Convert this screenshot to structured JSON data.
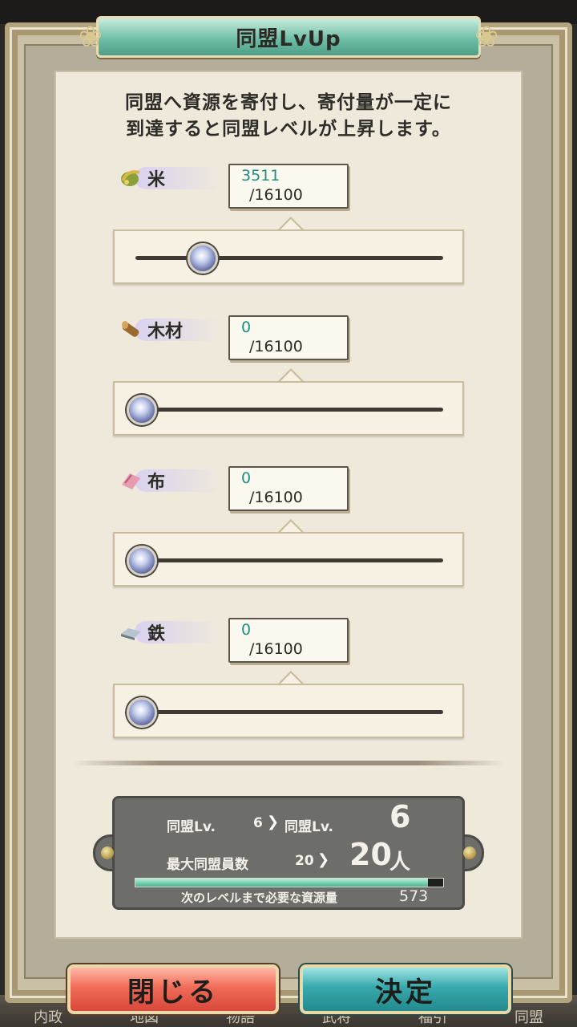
{
  "title": "同盟LvUp",
  "description": {
    "line1": "同盟へ資源を寄付し、寄付量が一定に",
    "line2": "到達すると同盟レベルが上昇します。"
  },
  "resources": [
    {
      "name": "米",
      "icon": "rice-icon",
      "current": "3511",
      "max": "/16100",
      "slider_fraction": 0.218
    },
    {
      "name": "木材",
      "icon": "wood-icon",
      "current": "0",
      "max": "/16100",
      "slider_fraction": 0
    },
    {
      "name": "布",
      "icon": "cloth-icon",
      "current": "0",
      "max": "/16100",
      "slider_fraction": 0
    },
    {
      "name": "鉄",
      "icon": "iron-icon",
      "current": "0",
      "max": "/16100",
      "slider_fraction": 0
    }
  ],
  "level_info": {
    "level_label": "同盟Lv.",
    "level_current": "6",
    "level_next_label": "同盟Lv.",
    "level_next": "6",
    "members_label": "最大同盟員数",
    "members_current": "20",
    "members_next": "20",
    "members_unit": "人",
    "progress_label": "次のレベルまで必要な資源量",
    "progress_value": "573",
    "progress_fraction": 0.95
  },
  "buttons": {
    "close": "閉じる",
    "confirm": "決定"
  },
  "bottom_nav": [
    "内政",
    "地図",
    "物語",
    "武将",
    "福引",
    "同盟"
  ],
  "colors": {
    "value_current": "#1f8f80",
    "close_button": "#f06c57",
    "confirm_button": "#37a9ac"
  }
}
